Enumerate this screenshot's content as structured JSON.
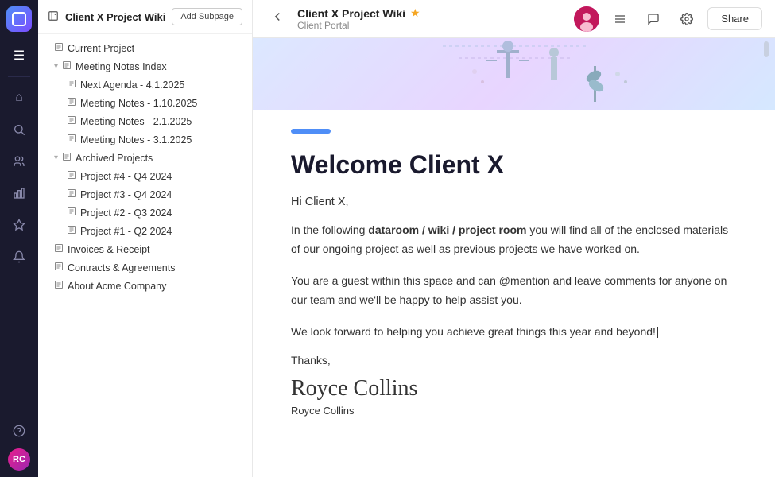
{
  "app": {
    "title": "Client X Project Wiki",
    "breadcrumb": "Client Portal",
    "star_icon": "★",
    "share_label": "Share"
  },
  "topbar": {
    "icons": {
      "back": "←",
      "menu_lines": "☰",
      "comment": "💬",
      "settings": "⚙"
    }
  },
  "sidebar": {
    "header_icon": "☰",
    "title": "Client X Project Wiki",
    "add_subpage_label": "Add Subpage",
    "items": [
      {
        "id": "current-project",
        "label": "Current Project",
        "level": 1,
        "icon": "☰",
        "toggle": null
      },
      {
        "id": "meeting-notes-index",
        "label": "Meeting Notes Index",
        "level": 1,
        "icon": "☰",
        "toggle": "▾"
      },
      {
        "id": "next-agenda",
        "label": "Next Agenda - 4.1.2025",
        "level": 2,
        "icon": "☰",
        "toggle": null
      },
      {
        "id": "meeting-notes-1",
        "label": "Meeting Notes - 1.10.2025",
        "level": 2,
        "icon": "☰",
        "toggle": null
      },
      {
        "id": "meeting-notes-2",
        "label": "Meeting Notes - 2.1.2025",
        "level": 2,
        "icon": "☰",
        "toggle": null
      },
      {
        "id": "meeting-notes-3",
        "label": "Meeting Notes - 3.1.2025",
        "level": 2,
        "icon": "☰",
        "toggle": null
      },
      {
        "id": "archived-projects",
        "label": "Archived Projects",
        "level": 1,
        "icon": "☰",
        "toggle": "▾"
      },
      {
        "id": "project-4",
        "label": "Project #4 - Q4 2024",
        "level": 2,
        "icon": "☰",
        "toggle": null
      },
      {
        "id": "project-3",
        "label": "Project #3 - Q4 2024",
        "level": 2,
        "icon": "☰",
        "toggle": null
      },
      {
        "id": "project-2",
        "label": "Project #2 - Q3 2024",
        "level": 2,
        "icon": "☰",
        "toggle": null
      },
      {
        "id": "project-1",
        "label": "Project #1 - Q2 2024",
        "level": 2,
        "icon": "☰",
        "toggle": null
      },
      {
        "id": "invoices",
        "label": "Invoices & Receipt",
        "level": 1,
        "icon": "☰",
        "toggle": null
      },
      {
        "id": "contracts",
        "label": "Contracts & Agreements",
        "level": 1,
        "icon": "☰",
        "toggle": null
      },
      {
        "id": "about",
        "label": "About Acme Company",
        "level": 1,
        "icon": "☰",
        "toggle": null
      }
    ]
  },
  "rail": {
    "icons": [
      {
        "id": "home",
        "symbol": "⌂",
        "active": false
      },
      {
        "id": "search",
        "symbol": "🔍",
        "active": false
      },
      {
        "id": "people",
        "symbol": "👥",
        "active": false
      },
      {
        "id": "chart",
        "symbol": "📊",
        "active": false
      },
      {
        "id": "star",
        "symbol": "⭐",
        "active": false
      },
      {
        "id": "bell",
        "symbol": "🔔",
        "active": false
      }
    ],
    "bottom": [
      {
        "id": "help",
        "symbol": "?"
      },
      {
        "id": "avatar",
        "initials": "RC"
      }
    ]
  },
  "content": {
    "accent_color": "#4f8ef7",
    "heading": "Welcome Client X",
    "greeting": "Hi Client X,",
    "paragraphs": [
      {
        "id": "p1",
        "text_before": "In the following ",
        "link_text": "dataroom / wiki / project room",
        "text_after": " you will find all of the enclosed materials of our ongoing project as well as previous projects we have worked on."
      },
      {
        "id": "p2",
        "text": "You are a guest within this space and can @mention and leave comments for anyone on our team and we'll be happy to help assist you."
      },
      {
        "id": "p3",
        "text": "We look forward to helping you achieve great things this year and beyond!"
      }
    ],
    "thanks": "Thanks,",
    "signature": "Royce Collins",
    "name_typed": "Royce Collins"
  }
}
